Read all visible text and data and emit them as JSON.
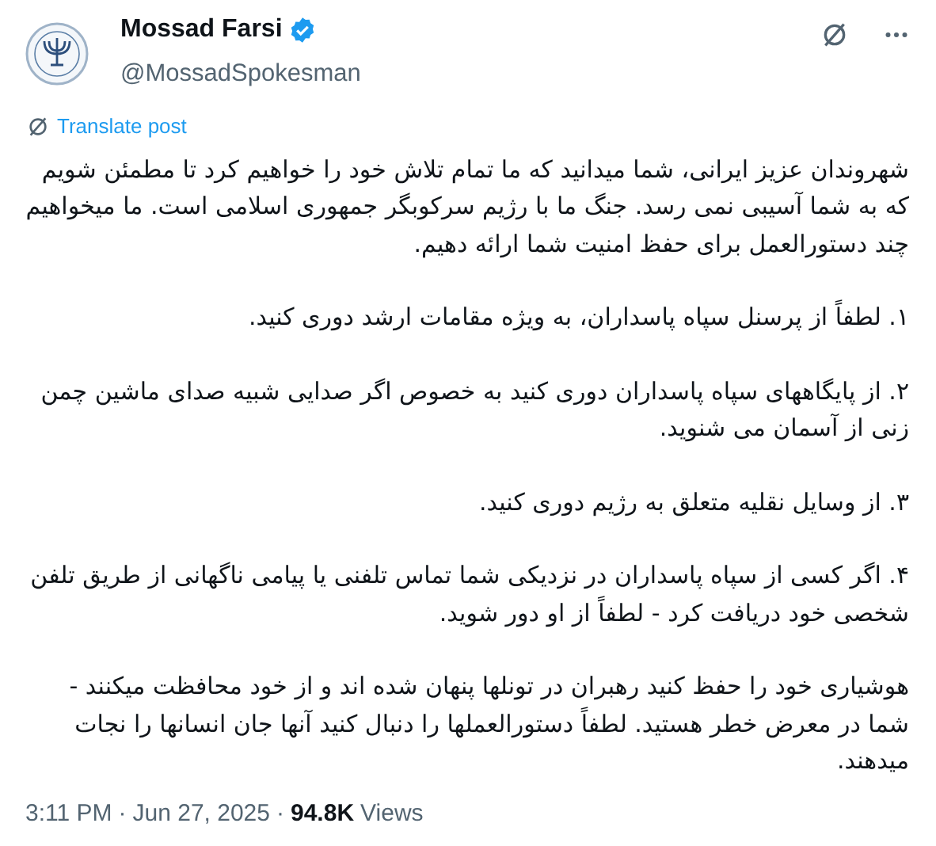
{
  "author": {
    "name": "Mossad Farsi",
    "handle": "@MossadSpokesman",
    "verified": true
  },
  "translate_link": "Translate post",
  "paragraphs": [
    "شهروندان عزیز ایرانی، شما میدانید که ما تمام تلاش خود را خواهیم کرد تا مطمئن شویم که به شما آسیبی نمی رسد. جنگ ما با رژیم سرکوبگر جمهوری اسلامی است. ما میخواهیم چند دستورالعمل برای حفظ امنیت شما ارائه دهیم.",
    "۱. لطفاً از پرسنل سپاه پاسداران، به ویژه مقامات ارشد دوری کنید.",
    "۲. از پایگاههای سپاه پاسداران دوری کنید به خصوص اگر صدایی شبیه صدای ماشین چمن زنی از آسمان می شنوید.",
    "۳. از وسایل نقلیه متعلق به رژیم دوری کنید.",
    "۴.  اگر کسی از سپاه پاسداران در نزدیکی شما تماس تلفنی یا پیامی ناگهانی از طریق تلفن شخصی خود دریافت کرد - لطفاً از او دور شوید.",
    "هوشیاری خود را حفظ کنید رهبران در تونلها پنهان شده اند و از خود محافظت میکنند - شما در معرض خطر هستید. لطفاً دستورالعملها را دنبال کنید آنها جان انسانها را نجات میدهند."
  ],
  "footer": {
    "time": "3:11 PM",
    "separator_1": "·",
    "date": "Jun 27, 2025",
    "separator_2": "·",
    "views_count": "94.8K",
    "views_label": "Views"
  }
}
